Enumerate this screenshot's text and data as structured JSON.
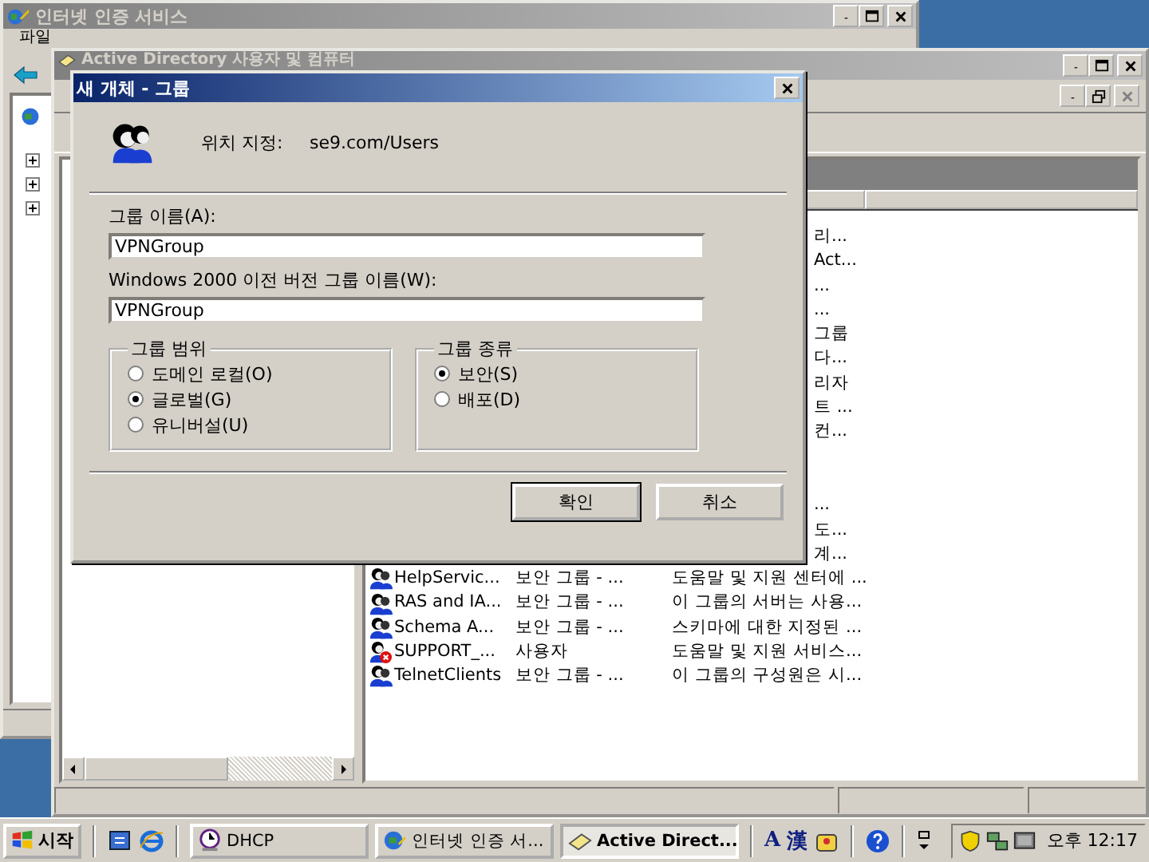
{
  "back_window": {
    "title": "인터넷 인증 서비스",
    "menu": [
      "파일"
    ]
  },
  "ad_window": {
    "title": "Active Directory 사용자 및 컴퓨터",
    "upper_fragments": [
      "리...",
      "Act...",
      "...",
      "...",
      "그룹",
      "다...",
      "리자",
      "트 ...",
      "컨..."
    ],
    "lower_fragments": [
      "...",
      "도...",
      "계..."
    ],
    "rows": [
      {
        "name": "HelpServic...",
        "type": "보안 그룹 - ...",
        "description": "도움말 및 지원 센터에 ...",
        "disabled": false
      },
      {
        "name": "RAS and IA...",
        "type": "보안 그룹 - ...",
        "description": "이 그룹의 서버는 사용...",
        "disabled": false
      },
      {
        "name": "Schema A...",
        "type": "보안 그룹 - ...",
        "description": "스키마에 대한 지정된 ...",
        "disabled": false
      },
      {
        "name": "SUPPORT_...",
        "type": "사용자",
        "description": "도움말 및 지원 서비스...",
        "disabled": true
      },
      {
        "name": "TelnetClients",
        "type": "보안 그룹 - ...",
        "description": "이 그룹의 구성원은 시...",
        "disabled": false
      }
    ]
  },
  "dialog": {
    "title": "새 개체 - 그룹",
    "location_label": "위치 지정:",
    "location": "se9.com/Users",
    "fields": [
      {
        "label": "그룹 이름(A):",
        "value": "VPNGroup"
      },
      {
        "label": "Windows 2000 이전 버전 그룹 이름(W):",
        "value": "VPNGroup"
      }
    ],
    "groups": [
      {
        "title": "그룹 범위",
        "options": [
          {
            "label": "도메인 로컬(O)",
            "selected": false
          },
          {
            "label": "글로벌(G)",
            "selected": true
          },
          {
            "label": "유니버설(U)",
            "selected": false
          }
        ]
      },
      {
        "title": "그룹 종류",
        "options": [
          {
            "label": "보안(S)",
            "selected": true
          },
          {
            "label": "배포(D)",
            "selected": false
          }
        ]
      }
    ],
    "buttons": [
      {
        "label": "확인",
        "default": true
      },
      {
        "label": "취소",
        "default": false
      }
    ]
  },
  "taskbar": {
    "start": "시작",
    "tasks": [
      {
        "label": "DHCP",
        "selected": false,
        "kind": "clock"
      },
      {
        "label": "인터넷 인증 서...",
        "selected": false,
        "kind": "globe"
      },
      {
        "label": "Active Direct...",
        "selected": true,
        "kind": "book"
      }
    ],
    "ime": [
      "A",
      "漢"
    ],
    "clock": "오후 12:17"
  }
}
